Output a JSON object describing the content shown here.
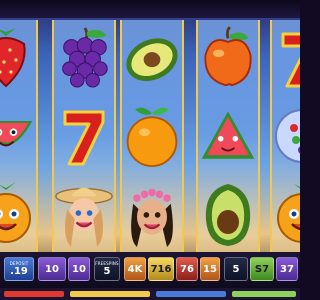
{
  "reels": {
    "reel1": [
      "strawberry",
      "watermelon",
      "orange-face"
    ],
    "reel2": [
      "grapes",
      "lucky-seven",
      "woman-sun-hat"
    ],
    "reel3": [
      "avocado",
      "orange",
      "woman-flower-crown"
    ],
    "reel4": [
      "apple",
      "watermelon-slice",
      "avocado"
    ],
    "reel5": [
      "lucky-seven",
      "berry-cup",
      "orange-face"
    ]
  },
  "buttons": [
    {
      "caption": "DEPOSIT",
      "value": ".19",
      "color": "blue"
    },
    {
      "caption": "",
      "value": "10",
      "color": "purple"
    },
    {
      "caption": "",
      "value": "10",
      "color": "purple"
    },
    {
      "caption": "FREESPINS",
      "value": "5",
      "color": "dark"
    },
    {
      "caption": "",
      "value": "4K",
      "color": "orange"
    },
    {
      "caption": "",
      "value": "716",
      "color": "yellow"
    },
    {
      "caption": "",
      "value": "76",
      "color": "red"
    },
    {
      "caption": "",
      "value": "15",
      "color": "orange"
    },
    {
      "caption": "",
      "value": "5",
      "color": "dark"
    },
    {
      "caption": "",
      "value": "S7",
      "color": "green"
    },
    {
      "caption": "",
      "value": "37",
      "color": "purple"
    }
  ],
  "colors": {
    "reel_border": "#f2c94c",
    "accent": "#e0392f"
  }
}
